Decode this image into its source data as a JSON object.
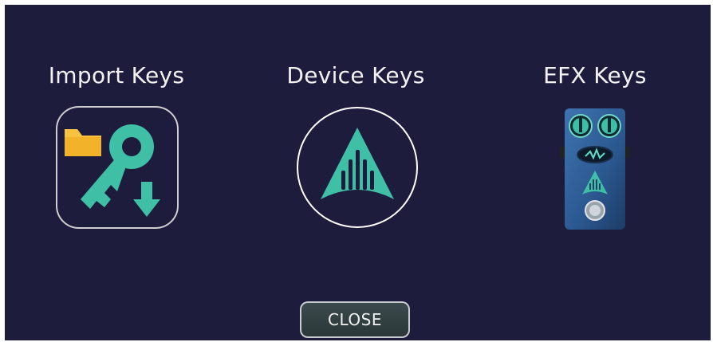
{
  "options": [
    {
      "label": "Import Keys",
      "icon": "import-keys-icon"
    },
    {
      "label": "Device Keys",
      "icon": "device-keys-icon"
    },
    {
      "label": "EFX Keys",
      "icon": "efx-pedal-icon"
    }
  ],
  "close_label": "CLOSE",
  "colors": {
    "background": "#1e1c3c",
    "accent": "#3fbfa6",
    "folder": "#f7c240",
    "pedal": "#2f5d96",
    "text": "#f2f2f2"
  }
}
